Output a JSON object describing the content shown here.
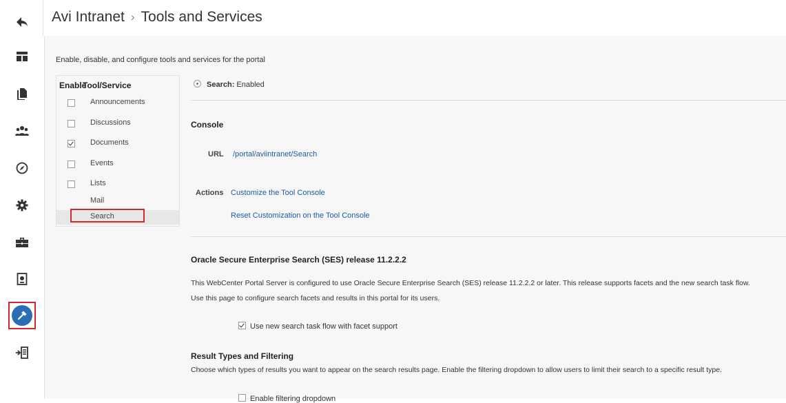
{
  "rail": {
    "items": [
      {
        "icon": "back-arrow-icon"
      },
      {
        "icon": "layout-icon"
      },
      {
        "icon": "documents-icon"
      },
      {
        "icon": "people-icon"
      },
      {
        "icon": "compass-icon"
      },
      {
        "icon": "gear-icon"
      },
      {
        "icon": "toolbox-icon"
      },
      {
        "icon": "device-icon"
      },
      {
        "icon": "hammer-icon",
        "active": true
      },
      {
        "icon": "exit-icon"
      }
    ]
  },
  "header": {
    "portal": "Avi Intranet",
    "separator": "›",
    "page": "Tools and Services"
  },
  "description": "Enable, disable, and configure tools and services for the portal",
  "tool_list": {
    "col_enable": "Enable",
    "col_tool": "Tool/Service",
    "items": [
      {
        "label": "Announcements",
        "checked": false
      },
      {
        "label": "Discussions",
        "checked": false
      },
      {
        "label": "Documents",
        "checked": true
      },
      {
        "label": "Events",
        "checked": false
      },
      {
        "label": "Lists",
        "checked": false
      },
      {
        "label": "Mail"
      },
      {
        "label": "Search",
        "selected": true
      }
    ]
  },
  "detail": {
    "status_label": "Search:",
    "status_value": "Enabled",
    "console_heading": "Console",
    "url_label": "URL",
    "url_value": "/portal/aviintranet/Search",
    "actions_label": "Actions",
    "action_customize": "Customize the Tool Console",
    "action_reset": "Reset Customization on the Tool Console",
    "ses_heading": "Oracle Secure Enterprise Search (SES) release 11.2.2.2",
    "ses_text_1": "This WebCenter Portal Server is configured to use Oracle Secure Enterprise Search (SES) release 11.2.2.2 or later. This release supports facets and the new search task flow.",
    "ses_text_2": "Use this page to configure search facets and results in this portal for its users.",
    "facet_checkbox": "Use new search task flow with facet support",
    "result_heading": "Result Types and Filtering",
    "result_text": "Choose which types of results you want to appear on the search results page. Enable the filtering dropdown to allow users to limit their search to a specific result type.",
    "filter_checkbox": "Enable filtering dropdown"
  },
  "colors": {
    "accent": "#2a6fb6",
    "highlight_border": "#d9262c",
    "link": "#1a5aa7"
  }
}
